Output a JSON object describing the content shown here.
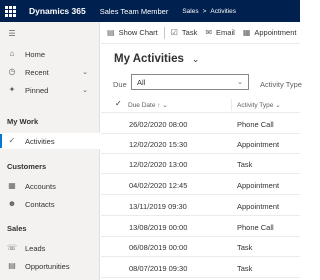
{
  "topbar": {
    "app_name": "Dynamics 365",
    "area": "Sales Team Member",
    "breadcrumb": [
      "Sales",
      "Activities"
    ]
  },
  "sidebar": {
    "top_items": [
      {
        "label": "Home",
        "icon": "home-icon"
      },
      {
        "label": "Recent",
        "icon": "clock-icon"
      },
      {
        "label": "Pinned",
        "icon": "pin-icon"
      }
    ],
    "groups": [
      {
        "title": "My Work",
        "items": [
          {
            "label": "Activities",
            "icon": "checkmark-icon",
            "active": true
          }
        ]
      },
      {
        "title": "Customers",
        "items": [
          {
            "label": "Accounts",
            "icon": "building-icon"
          },
          {
            "label": "Contacts",
            "icon": "person-icon"
          }
        ]
      },
      {
        "title": "Sales",
        "items": [
          {
            "label": "Leads",
            "icon": "phone-icon"
          },
          {
            "label": "Opportunities",
            "icon": "document-icon"
          }
        ]
      }
    ]
  },
  "commands": [
    {
      "label": "Show Chart",
      "icon": "chart-icon"
    },
    {
      "label": "Task",
      "icon": "task-icon"
    },
    {
      "label": "Email",
      "icon": "email-icon"
    },
    {
      "label": "Appointment",
      "icon": "calendar-icon"
    }
  ],
  "view": {
    "title": "My Activities"
  },
  "filters": {
    "due_label": "Due",
    "due_value": "All",
    "type_label": "Activity Type"
  },
  "grid": {
    "columns": [
      "Due Date",
      "Activity Type"
    ],
    "rows": [
      {
        "due": "26/02/2020 08:00",
        "type": "Phone Call"
      },
      {
        "due": "12/02/2020 15:30",
        "type": "Appointment"
      },
      {
        "due": "12/02/2020 13:00",
        "type": "Task"
      },
      {
        "due": "04/02/2020 12:45",
        "type": "Appointment"
      },
      {
        "due": "13/11/2019 09:30",
        "type": "Appointment"
      },
      {
        "due": "13/08/2019 00:00",
        "type": "Phone Call"
      },
      {
        "due": "06/08/2019 00:00",
        "type": "Task"
      },
      {
        "due": "08/07/2019 09:30",
        "type": "Task"
      }
    ]
  }
}
